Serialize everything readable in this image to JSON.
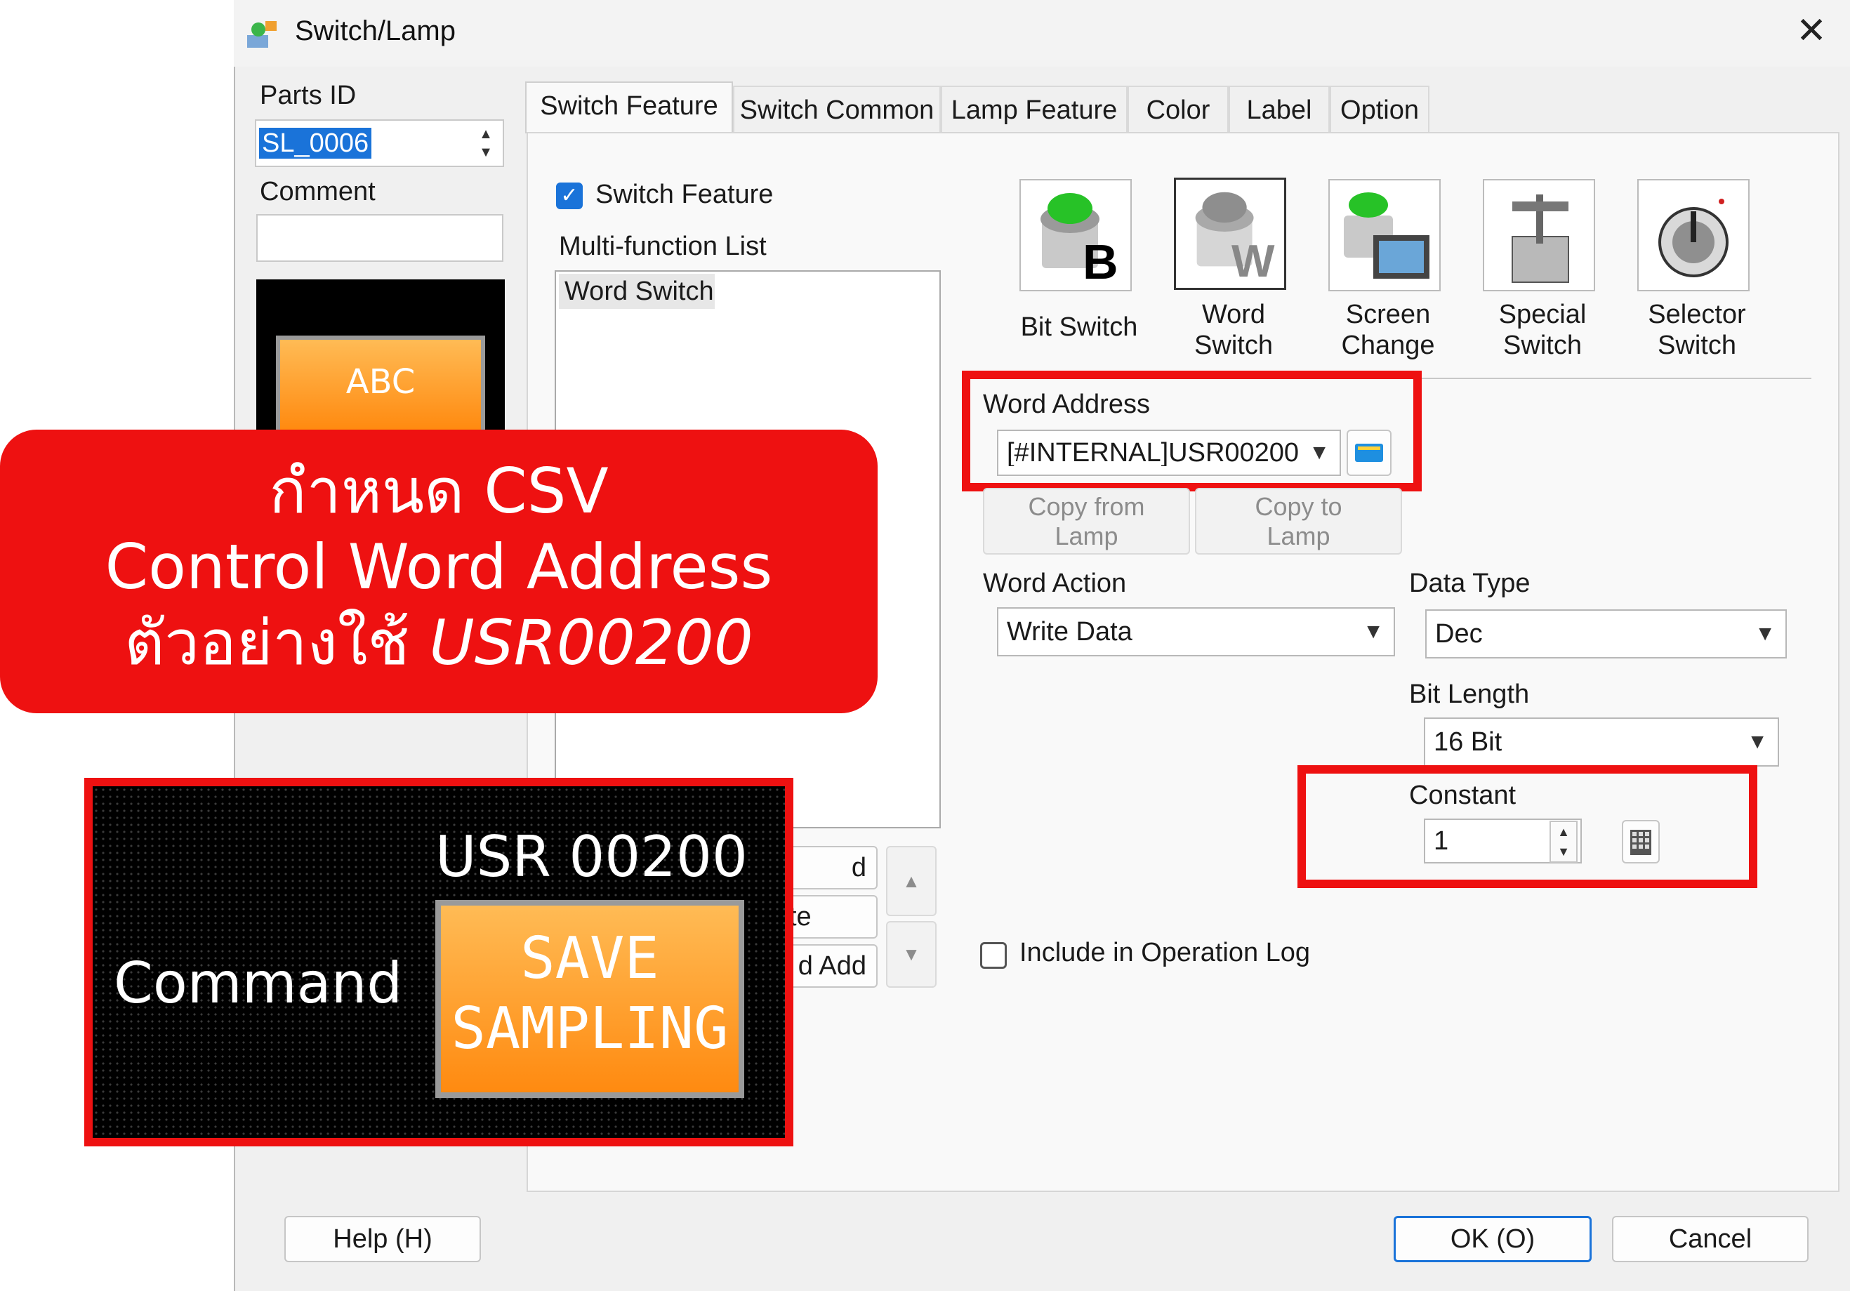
{
  "window": {
    "title": "Switch/Lamp"
  },
  "left": {
    "parts_id_label": "Parts ID",
    "parts_id_value": "SL_0006",
    "comment_label": "Comment",
    "comment_value": "",
    "preview_text": "ABC"
  },
  "tabs": [
    "Switch Feature",
    "Switch Common",
    "Lamp Feature",
    "Color",
    "Label",
    "Option"
  ],
  "switch_feature": {
    "checkbox_label": "Switch Feature",
    "checked": true,
    "list_label": "Multi-function List",
    "list_items": [
      "Word Switch"
    ],
    "hidden_buttons": [
      "d",
      "te",
      "d Add"
    ]
  },
  "switch_types": [
    {
      "line1": "Bit Switch",
      "line2": ""
    },
    {
      "line1": "Word",
      "line2": "Switch"
    },
    {
      "line1": "Screen",
      "line2": "Change"
    },
    {
      "line1": "Special",
      "line2": "Switch"
    },
    {
      "line1": "Selector",
      "line2": "Switch"
    }
  ],
  "word_address": {
    "label": "Word Address",
    "value": "[#INTERNAL]USR00200"
  },
  "copy_buttons": {
    "from_lamp_1": "Copy from",
    "from_lamp_2": "Lamp",
    "to_lamp_1": "Copy to",
    "to_lamp_2": "Lamp"
  },
  "word_action": {
    "label": "Word Action",
    "value": "Write Data"
  },
  "data_type": {
    "label": "Data Type",
    "value": "Dec"
  },
  "bit_length": {
    "label": "Bit Length",
    "value": "16 Bit"
  },
  "constant": {
    "label": "Constant",
    "value": "1"
  },
  "operation_log": {
    "label": "Include in Operation Log",
    "checked": false
  },
  "footer": {
    "help": "Help (H)",
    "ok": "OK (O)",
    "cancel": "Cancel"
  },
  "overlay": {
    "banner_line1": "กำหนด CSV",
    "banner_line2": "Control Word Address",
    "banner_line3a": "ตัวอย่างใช้ ",
    "banner_line3b": "USR00200",
    "panel_address": "USR 00200",
    "panel_label": "Command",
    "panel_button_line1": "SAVE",
    "panel_button_line2": "SAMPLING"
  },
  "colors": {
    "highlight_red": "#ee1111",
    "selection_blue": "#1a73d9",
    "button_orange": "#ff9a20"
  }
}
